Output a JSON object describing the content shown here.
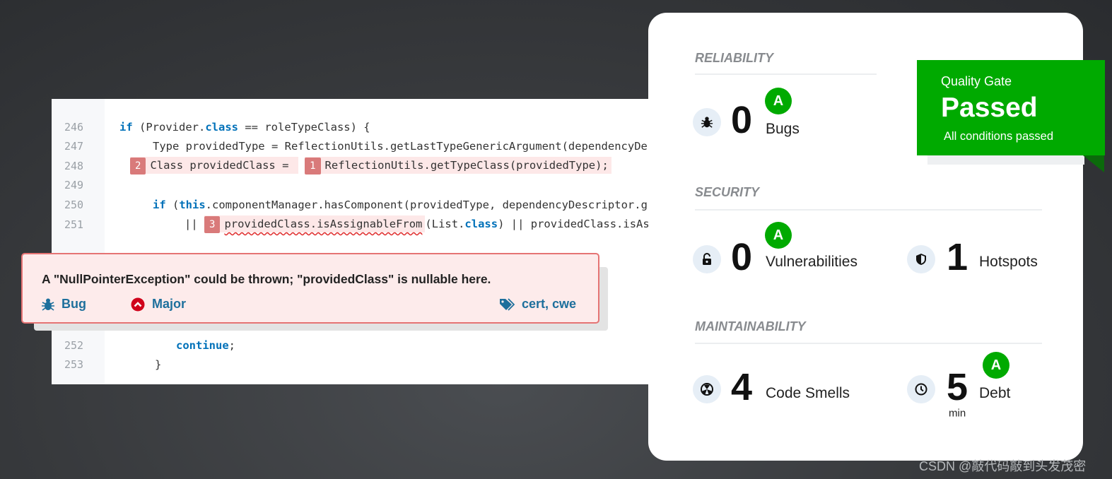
{
  "code": {
    "lines": [
      {
        "no": "246"
      },
      {
        "no": "247"
      },
      {
        "no": "248"
      },
      {
        "no": "249"
      },
      {
        "no": "250"
      },
      {
        "no": "251"
      },
      {
        "no": "252"
      },
      {
        "no": "253"
      }
    ],
    "l246": {
      "a": "if",
      " b": "",
      "b": " (Provider.",
      "c": "class",
      "d": " == roleTypeClass) {"
    },
    "l247": "Type providedType = ReflectionUtils.getLastTypeGenericArgument(dependencyDe",
    "l248": {
      "n2": "2",
      "a": "Class providedClass = ",
      "n1": "1",
      "b": "ReflectionUtils.getTypeClass(providedType);"
    },
    "l250": {
      "a": "if",
      "b": " (",
      "c": "this",
      "d": ".componentManager.hasComponent(providedType, dependencyDescriptor.g"
    },
    "l251": {
      "a": "|| ",
      "n3": "3",
      "b": "providedClass.isAssignableFrom",
      "c": "(List.",
      "d": "class",
      "e": ") || providedClass.isAs"
    },
    "l252": {
      "a": "continue",
      "b": ";"
    },
    "l253": "}"
  },
  "issue": {
    "message": "A \"NullPointerException\" could be thrown; \"providedClass\" is nullable here.",
    "type": "Bug",
    "type_icon": "bug-icon",
    "severity": "Major",
    "severity_icon": "major-severity-icon",
    "severity_color": "#d0021b",
    "tags": "cert, cwe",
    "tags_icon": "tag-icon"
  },
  "summary": {
    "reliability": {
      "title": "RELIABILITY",
      "bugs": {
        "value": "0",
        "label": "Bugs",
        "rating": "A"
      }
    },
    "security": {
      "title": "SECURITY",
      "vulnerabilities": {
        "value": "0",
        "label": "Vulnerabilities",
        "rating": "A"
      },
      "hotspots": {
        "value": "1",
        "label": "Hotspots"
      }
    },
    "maintainability": {
      "title": "MAINTAINABILITY",
      "code_smells": {
        "value": "4",
        "label": "Code Smells"
      },
      "debt": {
        "value": "5",
        "unit": "min",
        "label": "Debt",
        "rating": "A"
      }
    },
    "rating_color": "#00aa00"
  },
  "quality_gate": {
    "title": "Quality Gate",
    "status": "Passed",
    "detail": "All conditions passed",
    "color": "#00aa00"
  },
  "watermark": "CSDN @敲代码敲到头发茂密"
}
